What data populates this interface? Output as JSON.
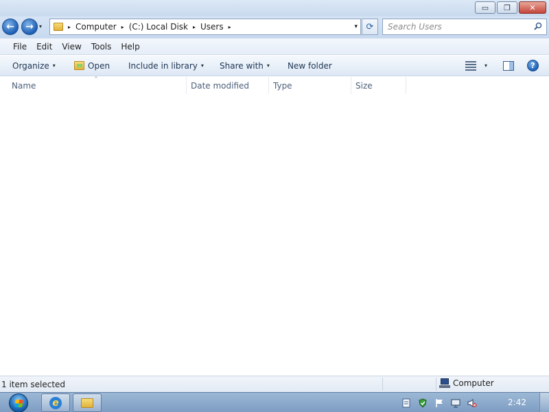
{
  "window": {
    "controls": {
      "minimize": "▭",
      "maximize": "❐",
      "close": "✕"
    }
  },
  "nav": {
    "back_glyph": "←",
    "forward_glyph": "→",
    "recent_glyph": "▾"
  },
  "address": {
    "crumbs": [
      "Computer",
      "(C:) Local Disk",
      "Users"
    ],
    "separator": "▸",
    "dropdown_glyph": "▾",
    "refresh_glyph": "⟳"
  },
  "search": {
    "placeholder": "Search Users"
  },
  "menu": {
    "items": [
      "File",
      "Edit",
      "View",
      "Tools",
      "Help"
    ]
  },
  "commands": {
    "organize": "Organize",
    "open": "Open",
    "include_in_library": "Include in library",
    "share_with": "Share with",
    "new_folder": "New folder",
    "caret": "▾",
    "help_glyph": "?"
  },
  "columns": {
    "name": "Name",
    "date_modified": "Date modified",
    "type": "Type",
    "size": "Size",
    "sort_glyph": "^"
  },
  "status": {
    "selection": "1 item selected",
    "location": "Computer"
  },
  "taskbar": {
    "ie_glyph": "e",
    "clock": "2:42"
  },
  "colors": {
    "accent": "#1d5fb4",
    "frame": "#c9daee",
    "taskbar": "#8aa8cb"
  }
}
